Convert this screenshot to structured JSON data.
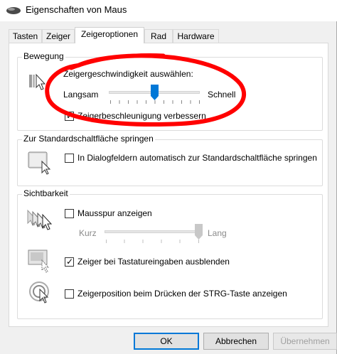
{
  "window": {
    "title": "Eigenschaften von Maus"
  },
  "tabs": [
    {
      "label": "Tasten"
    },
    {
      "label": "Zeiger"
    },
    {
      "label": "Zeigeroptionen"
    },
    {
      "label": "Rad"
    },
    {
      "label": "Hardware"
    }
  ],
  "active_tab": "Zeigeroptionen",
  "movement": {
    "title": "Bewegung",
    "speed_label": "Zeigergeschwindigkeit auswählen:",
    "slow_label": "Langsam",
    "fast_label": "Schnell",
    "speed_level": 0.5,
    "precision_label": "Zeigerbeschleunigung verbessern",
    "precision_checked": true
  },
  "snap": {
    "title": "Zur Standardschaltfläche springen",
    "label": "In Dialogfeldern automatisch zur Standardschaltfläche springen",
    "checked": false
  },
  "visibility": {
    "title": "Sichtbarkeit",
    "trails_label": "Mausspur anzeigen",
    "trails_checked": false,
    "short_label": "Kurz",
    "long_label": "Lang",
    "trails_level": 1.0,
    "hide_label": "Zeiger bei Tastatureingaben ausblenden",
    "hide_checked": true,
    "show_ctrl_label": "Zeigerposition beim Drücken der STRG-Taste anzeigen",
    "show_ctrl_checked": false
  },
  "buttons": {
    "ok": "OK",
    "cancel": "Abbrechen",
    "apply": "Übernehmen"
  },
  "colors": {
    "accent": "#0078d7",
    "annotation": "#ff0000"
  }
}
